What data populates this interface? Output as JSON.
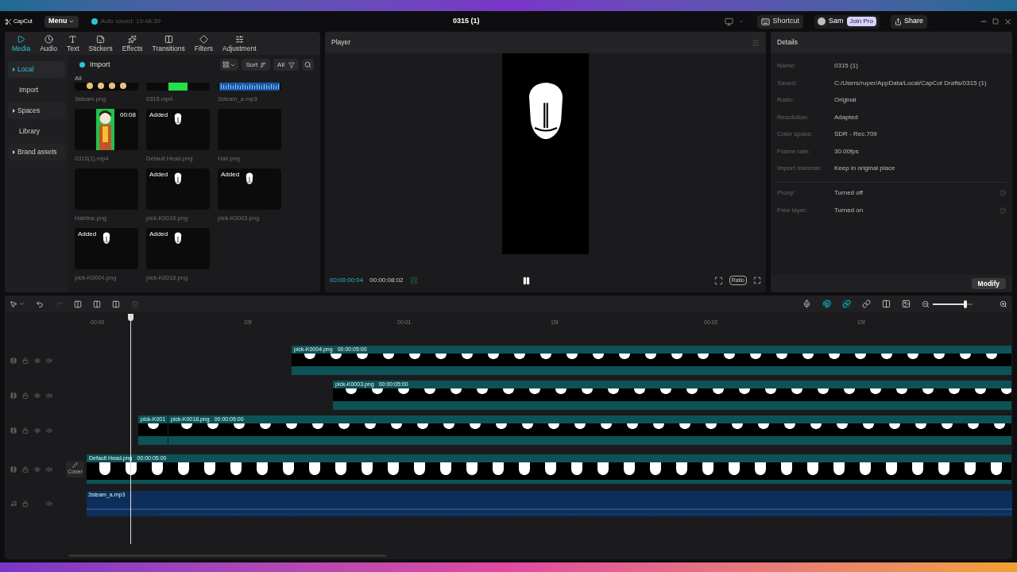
{
  "topbar": {
    "logo": "CapCut",
    "menu": "Menu",
    "autosave": "Auto saved: 19:48:39",
    "project_title": "0315 (1)",
    "shortcut": "Shortcut",
    "user": "Sam",
    "join_pro": "Join Pro",
    "share": "Share"
  },
  "media_tabs": [
    {
      "label": "Media",
      "kind": "media",
      "selected": true
    },
    {
      "label": "Audio",
      "kind": "audio",
      "selected": false
    },
    {
      "label": "Text",
      "kind": "text",
      "selected": false
    },
    {
      "label": "Stickers",
      "kind": "stickers",
      "selected": false
    },
    {
      "label": "Effects",
      "kind": "effects",
      "selected": false
    },
    {
      "label": "Transitions",
      "kind": "transitions",
      "selected": false
    },
    {
      "label": "Filters",
      "kind": "filters",
      "selected": false
    },
    {
      "label": "Adjustment",
      "kind": "adjustment",
      "selected": false
    }
  ],
  "media_sidebar": [
    {
      "label": "Local",
      "expandable": true,
      "selected": true
    },
    {
      "label": "Import",
      "expandable": false,
      "selected": false
    },
    {
      "label": "Spaces",
      "expandable": true,
      "selected": false
    },
    {
      "label": "Library",
      "expandable": false,
      "selected": false
    },
    {
      "label": "Brand assets",
      "expandable": true,
      "selected": false
    }
  ],
  "media_toolbar": {
    "import": "Import",
    "sort": "Sort",
    "filter": "All"
  },
  "media_section": "All",
  "media_items": [
    {
      "name": "3steam.png",
      "kind": "faces"
    },
    {
      "name": "0315.mp4",
      "kind": "green"
    },
    {
      "name": "3steam_a.mp3",
      "kind": "audio"
    },
    {
      "name": "0315(1).mp4",
      "kind": "video",
      "duration": "00:08"
    },
    {
      "name": "Default Head.png",
      "kind": "head",
      "badge": "Added"
    },
    {
      "name": "Hair.png",
      "kind": "dark"
    },
    {
      "name": "Hairline.png",
      "kind": "dark"
    },
    {
      "name": "pick-K0016.png",
      "kind": "head",
      "badge": "Added"
    },
    {
      "name": "pick-K0003.png",
      "kind": "head",
      "badge": "Added"
    },
    {
      "name": "pick-K0004.png",
      "kind": "head",
      "badge": "Added"
    },
    {
      "name": "pick-K0018.png",
      "kind": "head",
      "badge": "Added"
    }
  ],
  "player": {
    "title": "Player",
    "current_time": "00:00:00:04",
    "duration": "00:00:08:02",
    "ratio": "Ratio",
    "playing": true
  },
  "details": {
    "title": "Details",
    "rows": [
      {
        "label": "Name:",
        "value": "0315 (1)"
      },
      {
        "label": "Saved:",
        "value": "C:/Users/ruper/AppData/Local/CapCut Drafts/0315 (1)"
      },
      {
        "label": "Ratio:",
        "value": "Original"
      },
      {
        "label": "Resolution:",
        "value": "Adapted"
      },
      {
        "label": "Color space:",
        "value": "SDR - Rec.709"
      },
      {
        "label": "Frame rate:",
        "value": "30.00fps"
      },
      {
        "label": "Import material:",
        "value": "Keep in original place"
      }
    ],
    "settings": [
      {
        "label": "Proxy:",
        "value": "Turned off"
      },
      {
        "label": "Free layer:",
        "value": "Turned on"
      }
    ],
    "modify": "Modify"
  },
  "timeline": {
    "zoom": {
      "level": 0.82
    },
    "ruler": [
      "00:00",
      "15f",
      "00:01",
      "15f",
      "00:02",
      "15f"
    ],
    "cover": "Cover",
    "tracks": [
      {
        "kind": "video",
        "clips": [
          {
            "name": "pick-K0004.png",
            "duration": "00:00:05:00"
          }
        ]
      },
      {
        "kind": "video",
        "clips": [
          {
            "name": "pick-K0003.png",
            "duration": "00:00:05:00"
          }
        ]
      },
      {
        "kind": "video",
        "clips": [
          {
            "name": "pick-K001"
          },
          {
            "name": "pick-K0018.png",
            "duration": "00:00:05:00"
          }
        ]
      },
      {
        "kind": "main",
        "clips": [
          {
            "name": "Default Head.png",
            "duration": "00:00:05:00"
          }
        ]
      },
      {
        "kind": "audio",
        "clips": [
          {
            "name": "3steam_a.mp3"
          }
        ]
      }
    ]
  }
}
